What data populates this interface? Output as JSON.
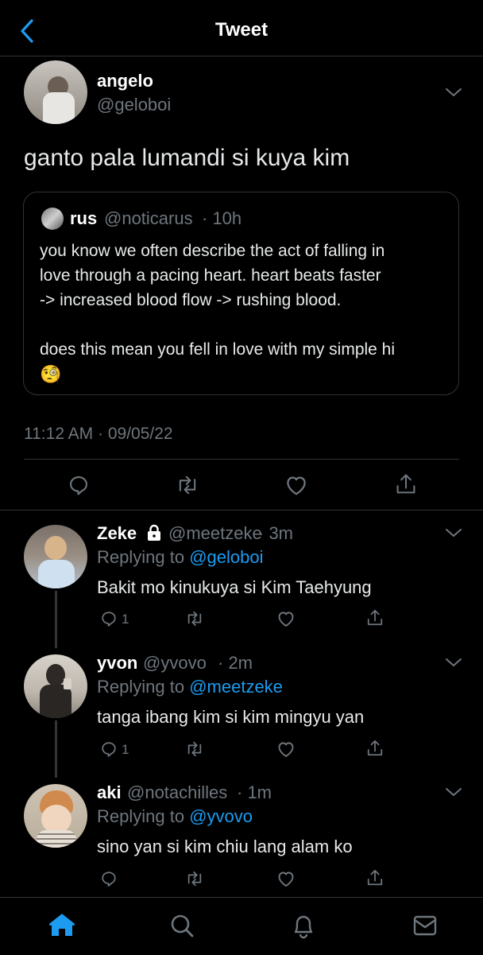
{
  "header": {
    "title": "Tweet"
  },
  "main_tweet": {
    "name": "angelo",
    "handle": "@geloboi",
    "text": "ganto pala lumandi si kuya kim",
    "timestamp": "11:12 AM · 09/05/22",
    "quote": {
      "name": "rus",
      "handle": "@noticarus",
      "time": "· 10h",
      "line1": "you know we often describe the act of falling in",
      "line2": "love through a pacing heart. heart beats faster",
      "line3": "-> increased blood flow -> rushing blood.",
      "line4": "does this mean you fell in love with my simple hi",
      "emoji": "🧐"
    }
  },
  "replies": [
    {
      "name": "Zeke",
      "handle": "@meetzeke",
      "time": "· 3m",
      "replying_prefix": "Replying to",
      "replying_to": "@geloboi",
      "text": "Bakit mo kinukuya si Kim Taehyung",
      "reply_count": "1"
    },
    {
      "name": "yvon",
      "handle": "@yvovo",
      "time": "· 2m",
      "replying_prefix": "Replying to",
      "replying_to": "@meetzeke",
      "text": "tanga ibang kim si kim mingyu yan",
      "reply_count": "1"
    },
    {
      "name": "aki",
      "handle": "@notachilles",
      "time": "· 1m",
      "replying_prefix": "Replying to",
      "replying_to": "@yvovo",
      "text": "sino yan si kim chiu lang alam ko",
      "reply_count": ""
    }
  ],
  "icons": {
    "back": "chevron-left-icon",
    "more": "chevron-down-icon",
    "reply": "reply-icon",
    "retweet": "retweet-icon",
    "like": "heart-icon",
    "share": "share-icon",
    "lock": "lock-icon",
    "home": "home-icon",
    "search": "search-icon",
    "notifications": "bell-icon",
    "messages": "mail-icon"
  },
  "colors": {
    "accent": "#1d9bf0",
    "background": "#000000",
    "muted": "#6e767d",
    "border": "#2f3336"
  }
}
